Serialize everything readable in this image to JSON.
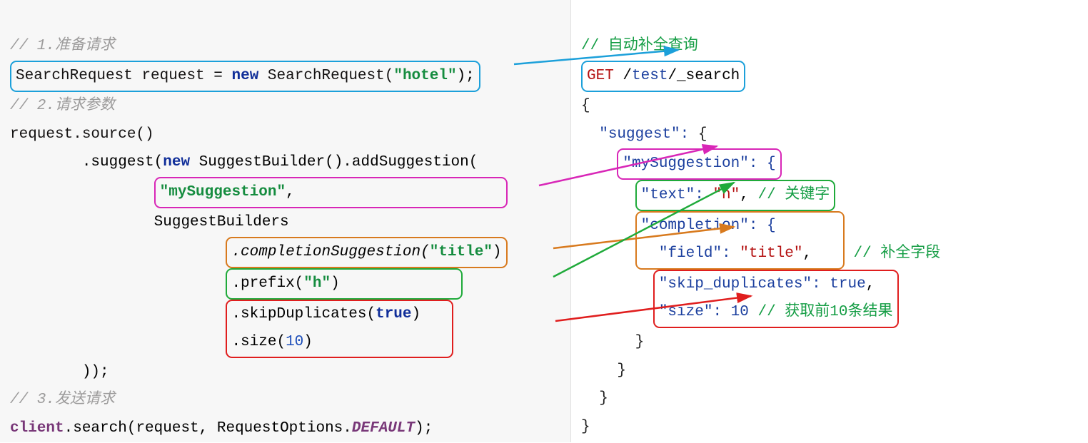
{
  "left": {
    "comment1": "// 1.准备请求",
    "line_request": {
      "type": "SearchRequest ",
      "var": "request ",
      "eq": "= ",
      "kw": "new ",
      "ctor": "SearchRequest(",
      "arg": "\"hotel\"",
      "end": ");"
    },
    "comment2": "// 2.请求参数",
    "source_call": "request.source()",
    "suggest_call": {
      "pre": "        .suggest(",
      "kw": "new ",
      "builder": "SuggestBuilder().addSuggestion("
    },
    "mySuggestion": "\"mySuggestion\"",
    "mySuggestion_comma": ",",
    "suggestBuilders": "                SuggestBuilders",
    "completion": {
      "method": ".completionSuggestion(",
      "arg": "\"title\"",
      "end": ")"
    },
    "prefix": {
      "method": ".prefix(",
      "arg": "\"h\"",
      "end": ")"
    },
    "skip": {
      "method": ".skipDuplicates(",
      "arg": "true",
      "end": ")"
    },
    "size": {
      "method": ".size(",
      "arg": "10",
      "end": ")"
    },
    "close_suggest": "        ));",
    "comment3": "// 3.发送请求",
    "send": {
      "client": "client",
      "call": ".search(request, RequestOptions.",
      "default": "DEFAULT",
      "end": ");"
    }
  },
  "right": {
    "comment_top": "// 自动补全查询",
    "get": "GET",
    "slash": " /",
    "path": "test",
    "path_rest": "/_search",
    "open": "{",
    "suggest_open": "  ",
    "k_suggest": "\"suggest\": ",
    "brace_l": "{",
    "k_mySuggestion": "\"mySuggestion\": {",
    "k_text": "\"text\": ",
    "v_text": "\"h\"",
    "comma": ", ",
    "comment_keyword": "// 关键字",
    "k_completion": "\"completion\": {",
    "k_field": "\"field\": ",
    "v_field": "\"title\"",
    "comment_field": " // 补全字段",
    "k_skip": "\"skip_duplicates\": ",
    "v_skip": "true",
    "k_size": "\"size\": ",
    "v_size": "10",
    "comment_size": " // 获取前10条结果",
    "brace_r": "}",
    "brace_r2": "    }",
    "brace_r3": "  }",
    "brace_r4": "}"
  }
}
